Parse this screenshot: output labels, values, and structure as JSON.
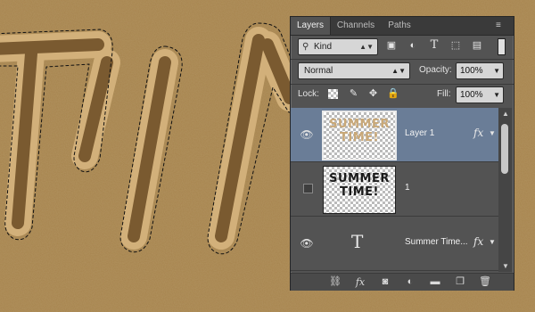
{
  "background": {
    "colors": {
      "sand": "#a7844e",
      "groove": "#7b5c31",
      "ridge": "#d3b17a"
    }
  },
  "panel": {
    "tabs": [
      {
        "label": "Layers",
        "active": true
      },
      {
        "label": "Channels",
        "active": false
      },
      {
        "label": "Paths",
        "active": false
      }
    ],
    "menu_icon": "panel-menu-icon",
    "filter": {
      "kind_label": "Kind",
      "icons": [
        "image-filter-icon",
        "adjustment-filter-icon",
        "type-filter-icon",
        "shape-filter-icon",
        "smart-object-filter-icon"
      ]
    },
    "blend_mode": "Normal",
    "opacity_label": "Opacity:",
    "opacity_value": "100%",
    "lock_label": "Lock:",
    "lock_icons": [
      "lock-transparent-icon",
      "lock-paint-icon",
      "lock-position-icon",
      "lock-all-icon"
    ],
    "fill_label": "Fill:",
    "fill_value": "100%",
    "layers": [
      {
        "name": "Layer 1",
        "visible": true,
        "selected": true,
        "thumb_text": "SUMMER TIME!",
        "fx": "fx"
      },
      {
        "name": "1",
        "visible": false,
        "selected": false,
        "thumb_text": "SUMMER TIME!",
        "fx": ""
      },
      {
        "name": "Summer Time...",
        "visible": true,
        "selected": false,
        "thumb_text": "T",
        "fx": "fx"
      }
    ],
    "footer_icons": [
      "link-layers-icon",
      "add-style-icon",
      "add-mask-icon",
      "adjustment-layer-icon",
      "new-group-icon",
      "new-layer-icon",
      "delete-layer-icon"
    ],
    "colors": {
      "panel_bg": "#535353",
      "selection": "#6a7d97"
    }
  }
}
